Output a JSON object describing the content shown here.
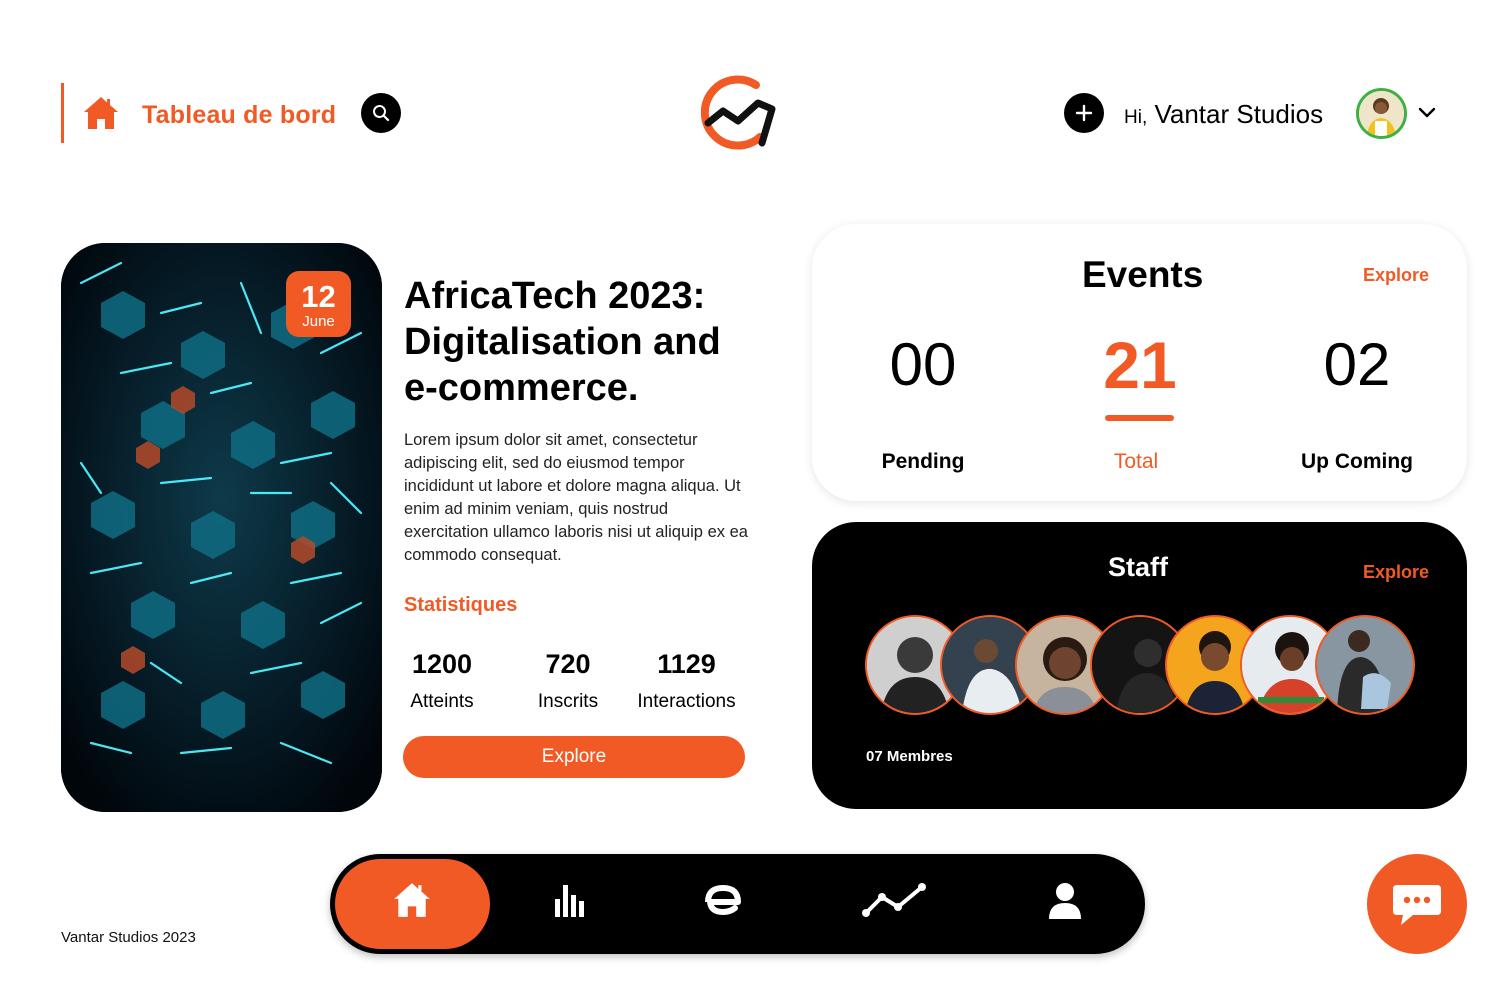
{
  "header": {
    "page_title": "Tableau de bord",
    "greeting_prefix": "Hi,",
    "user_name": "Vantar Studios"
  },
  "event": {
    "date_day": "12",
    "date_month": "June",
    "title": "AfricaTech 2023: Digitalisation and e-commerce.",
    "description": "Lorem ipsum dolor sit amet, consectetur adipiscing elit, sed do eiusmod tempor incididunt ut labore et dolore magna aliqua. Ut enim ad minim veniam, quis nostrud exercitation ullamco laboris nisi ut aliquip ex ea commodo consequat.",
    "stats_heading": "Statistiques",
    "stats": [
      {
        "value": "1200",
        "label": "Atteints"
      },
      {
        "value": "720",
        "label": "Inscrits"
      },
      {
        "value": "1129",
        "label": "Interactions"
      }
    ],
    "explore_label": "Explore"
  },
  "events_card": {
    "title": "Events",
    "explore_label": "Explore",
    "counts": [
      {
        "value": "00",
        "label": "Pending"
      },
      {
        "value": "21",
        "label": "Total"
      },
      {
        "value": "02",
        "label": "Up Coming"
      }
    ]
  },
  "staff_card": {
    "title": "Staff",
    "explore_label": "Explore",
    "members_label": "07 Membres"
  },
  "footer": {
    "copyright": "Vantar Studios 2023"
  },
  "colors": {
    "accent": "#f15a24",
    "dark": "#000000",
    "avatar_ring": "#3cb043"
  },
  "icons": {
    "home": "home-icon",
    "search": "search-icon",
    "add": "plus-icon",
    "chevron": "chevron-down-icon",
    "stats": "bar-chart-icon",
    "events": "e-icon",
    "trend": "trend-line-icon",
    "profile": "user-icon",
    "chat": "chat-bubble-icon"
  }
}
